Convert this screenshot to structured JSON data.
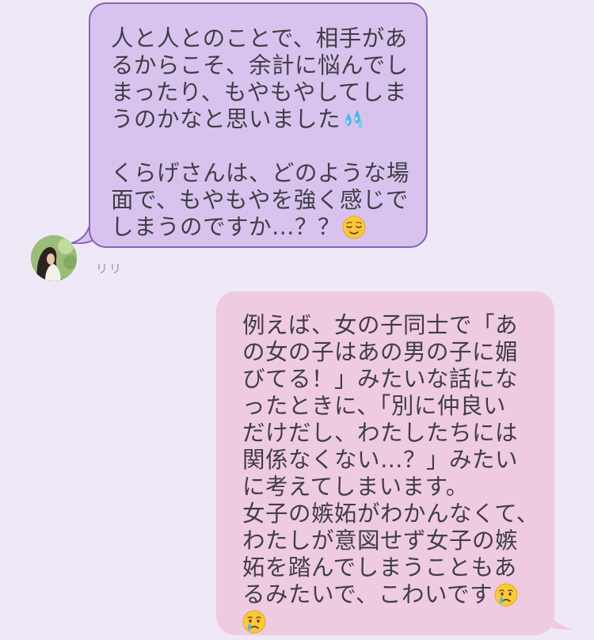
{
  "chat": {
    "received": {
      "sender": "リリ",
      "lines": [
        "人と人とのことで、相手があ",
        "るからこそ、余計に悩んでし",
        "まったり、もやもやしてしま",
        "うのかなと思いました",
        "",
        "くらげさんは、どのような場",
        "面で、もやもやを強く感じで",
        "しまうのですか…？？"
      ],
      "emojis": [
        "sweat-droplets-emoji",
        "relieved-face-emoji"
      ]
    },
    "sent": {
      "lines": [
        "例えば、女の子同士で「あ",
        "の女の子はあの男の子に媚",
        "びてる！」みたいな話にな",
        "ったときに、「別に仲良い",
        "だけだし、わたしたちには",
        "関係なくない…？」みたい",
        "に考えてしまいます。",
        "女子の嫉妬がわかんなくて、",
        "わたしが意図せず女子の嫉",
        "妬を踏んでしまうこともあ",
        "るみたいで、こわいです"
      ],
      "emojis": [
        "crying-face-emoji",
        "crying-face-emoji"
      ]
    }
  },
  "colors": {
    "background": "#efe9f7",
    "received_bubble": "#d8c3ef",
    "received_border": "#8763b3",
    "sent_bubble": "#efcbe0",
    "text": "#3f3e45"
  }
}
